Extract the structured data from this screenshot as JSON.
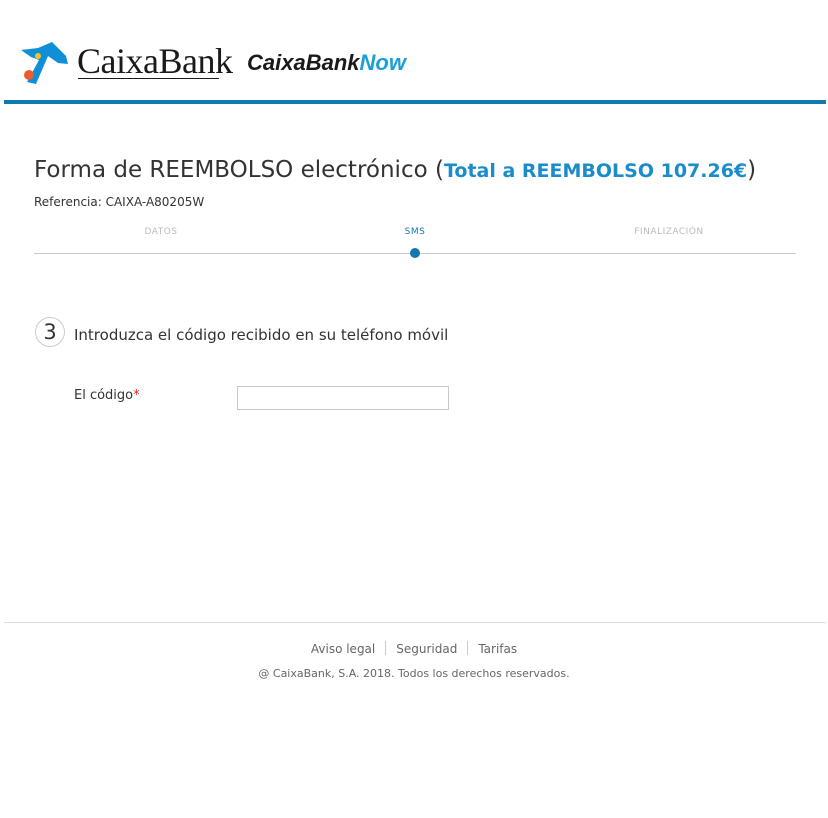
{
  "header": {
    "brand_name": "CaixaBank",
    "now_logo_part_a": "CaixaBank",
    "now_logo_part_b": "Now",
    "colors": {
      "bar": "#1179b0",
      "now_accent": "#1a9fd9"
    },
    "icon": "caixabank-star-icon"
  },
  "form": {
    "title": "Forma de REEMBOLSO electrónico",
    "paren_open": " (",
    "total": "Total a REEMBOLSO 107.26€",
    "paren_close": ")",
    "reference": "Referencia: CAIXA-A80205W"
  },
  "steps": {
    "items": [
      {
        "label": "DATOS",
        "state": "done"
      },
      {
        "label": "SMS",
        "state": "active"
      },
      {
        "label": "FINALIZACIÓN",
        "state": "pending"
      }
    ],
    "active_color": "#1179b0"
  },
  "section": {
    "number": "3",
    "title": "Introduzca el código recibido en su teléfono móvil",
    "code_label": "El código",
    "required_mark": "*",
    "code_value": ""
  },
  "footer": {
    "links": [
      "Aviso legal",
      "Seguridad",
      "Tarifas"
    ],
    "copyright": "@ CaixaBank, S.A. 2018. Todos los derechos reservados."
  }
}
